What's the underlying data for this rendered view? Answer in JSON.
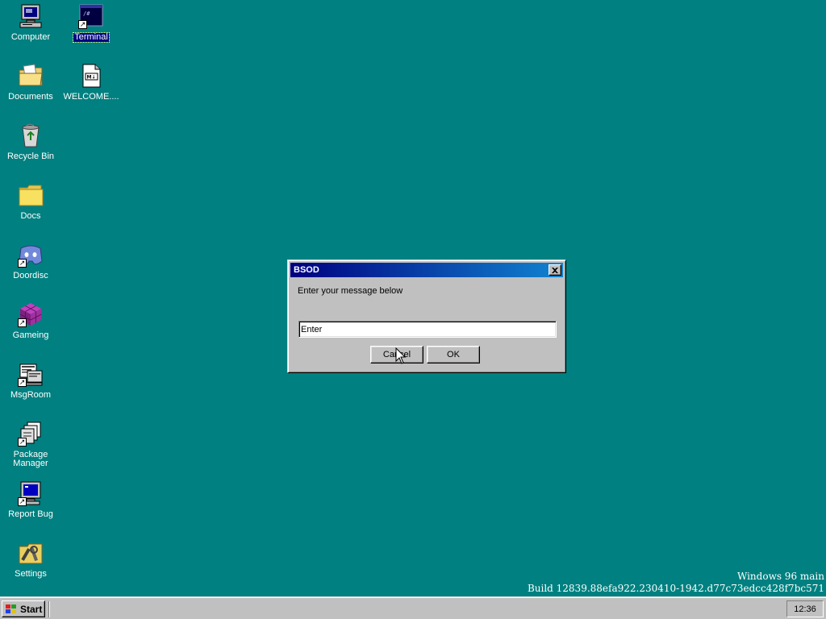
{
  "desktop": {
    "background_color": "#008080",
    "icons": [
      {
        "label": "Computer",
        "icon": "computer-icon",
        "shortcut": false,
        "selected": false
      },
      {
        "label": "Terminal",
        "icon": "terminal-icon",
        "shortcut": true,
        "selected": true
      },
      {
        "label": "Documents",
        "icon": "documents-folder-icon",
        "shortcut": false,
        "selected": false
      },
      {
        "label": "WELCOME....",
        "icon": "markdown-file-icon",
        "shortcut": false,
        "selected": false
      },
      {
        "label": "Recycle Bin",
        "icon": "recycle-bin-icon",
        "shortcut": false,
        "selected": false
      },
      {
        "label": "Docs",
        "icon": "folder-icon",
        "shortcut": false,
        "selected": false
      },
      {
        "label": "Doordisc",
        "icon": "doordisc-icon",
        "shortcut": true,
        "selected": false
      },
      {
        "label": "Gameing",
        "icon": "game-cube-icon",
        "shortcut": true,
        "selected": false
      },
      {
        "label": "MsgRoom",
        "icon": "msgroom-icon",
        "shortcut": true,
        "selected": false
      },
      {
        "label": "Package Manager",
        "icon": "package-manager-icon",
        "shortcut": true,
        "selected": false
      },
      {
        "label": "Report Bug",
        "icon": "report-bug-icon",
        "shortcut": true,
        "selected": false
      },
      {
        "label": "Settings",
        "icon": "settings-icon",
        "shortcut": false,
        "selected": false
      }
    ]
  },
  "watermark": {
    "line1": "Windows 96 main",
    "line2": "Build 12839.88efa922.230410-1942.d77c73edcc428f7bc571"
  },
  "dialog": {
    "title": "BSOD",
    "message": "Enter your message below",
    "input_value": "Enter",
    "cancel_label": "Cancel",
    "ok_label": "OK",
    "titlebar_colors": [
      "#000080",
      "#1084d0"
    ]
  },
  "taskbar": {
    "start_label": "Start",
    "clock": "12:36"
  }
}
